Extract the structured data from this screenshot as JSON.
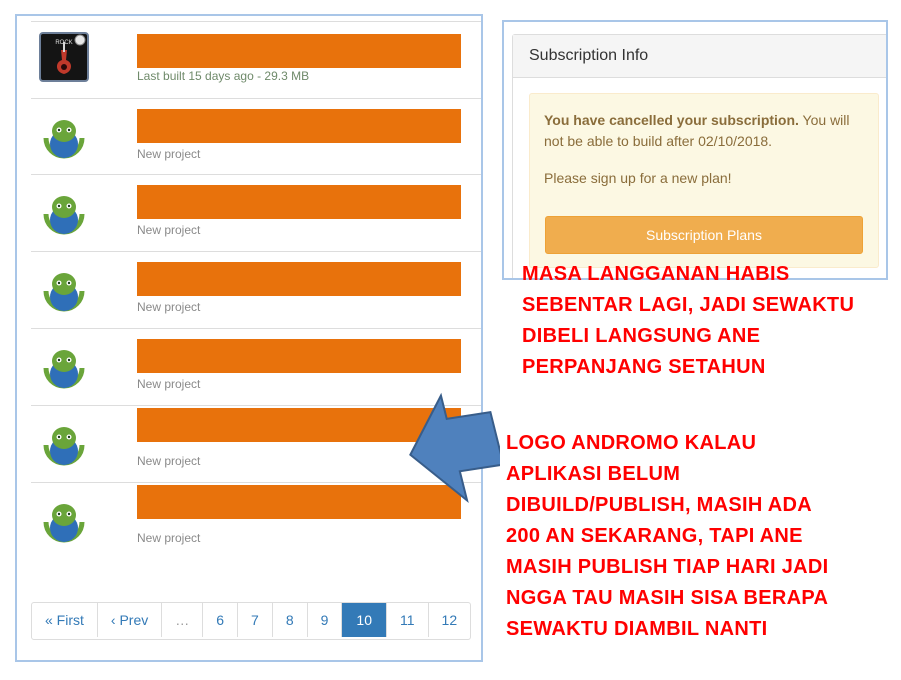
{
  "projects": [
    {
      "meta": "Last built 15 days ago - 29.3 MB",
      "icon": "rock-app-icon"
    },
    {
      "meta": "New project",
      "icon": "android-robot-icon"
    },
    {
      "meta": "New project",
      "icon": "android-robot-icon"
    },
    {
      "meta": "New project",
      "icon": "android-robot-icon"
    },
    {
      "meta": "New project",
      "icon": "android-robot-icon"
    },
    {
      "meta": "New project",
      "icon": "android-robot-icon"
    },
    {
      "meta": "New project",
      "icon": "android-robot-icon"
    }
  ],
  "pagination": {
    "first": "« First",
    "prev": "‹ Prev",
    "ellipsis": "…",
    "pages": [
      "6",
      "7",
      "8",
      "9",
      "10",
      "11",
      "12"
    ],
    "active": "10"
  },
  "subscription": {
    "heading": "Subscription Info",
    "alert_strong": "You have cancelled your subscription.",
    "alert_rest": " You will not be able to build after 02/10/2018.",
    "signup": "Please sign up for a new plan!",
    "button": "Subscription Plans"
  },
  "annotations": {
    "note1": [
      "MASA LANGGANAN HABIS",
      "SEBENTAR LAGI, JADI SEWAKTU",
      "DIBELI LANGSUNG ANE",
      "PERPANJANG SETAHUN"
    ],
    "note2": [
      "LOGO ANDROMO KALAU",
      "APLIKASI BELUM",
      "DIBUILD/PUBLISH, MASIH ADA",
      "200 AN SEKARANG, TAPI ANE",
      "MASIH PUBLISH TIAP HARI JADI",
      "NGGA TAU MASIH SISA BERAPA",
      "SEWAKTU DIAMBIL NANTI"
    ]
  },
  "colors": {
    "redaction": "#e8720c",
    "active_page": "#337ab7",
    "button": "#f0ad4e",
    "annotation": "#ff0000",
    "arrow": "#4f81bd"
  }
}
